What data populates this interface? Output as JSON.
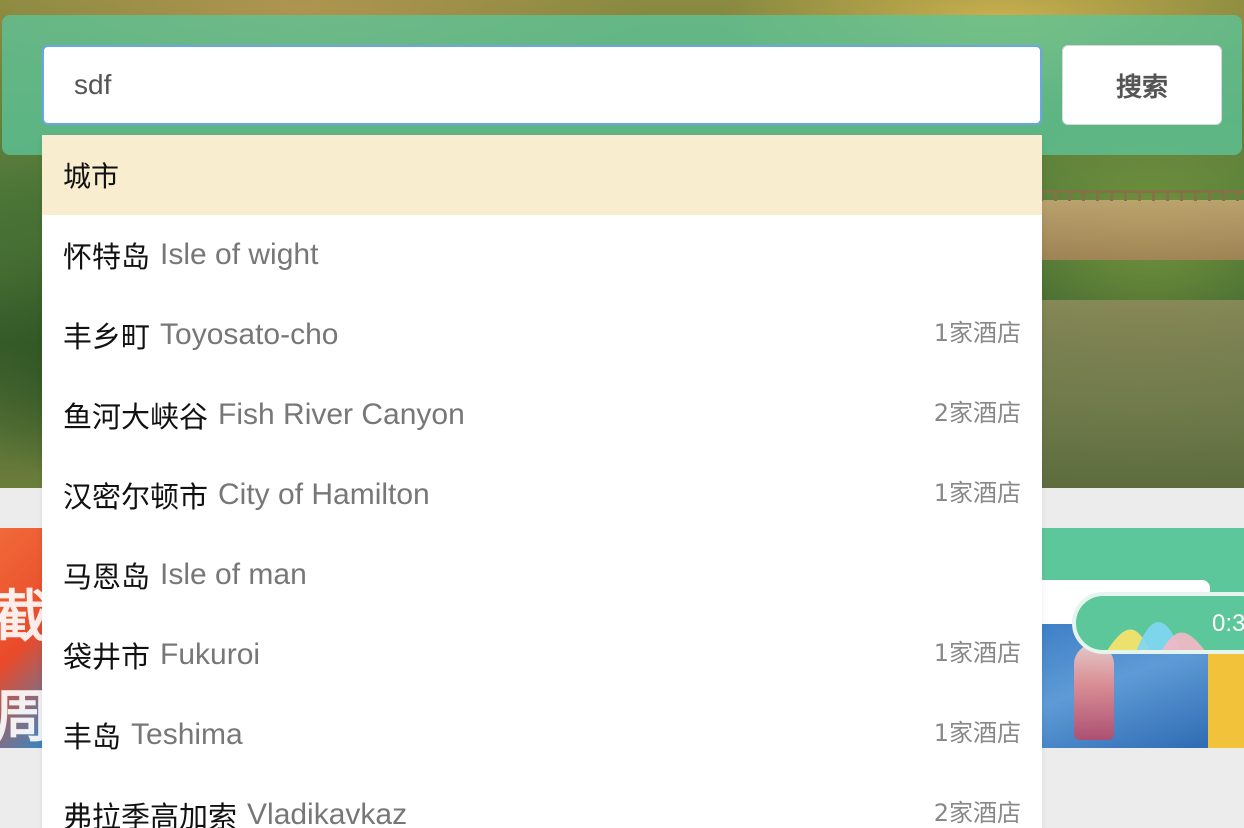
{
  "search": {
    "value": "sdf",
    "button_label": "搜索"
  },
  "dropdown": {
    "section_header": "城市",
    "items": [
      {
        "zh": "怀特岛",
        "en": "Isle of wight",
        "count": ""
      },
      {
        "zh": "丰乡町",
        "en": "Toyosato-cho",
        "count": "1家酒店"
      },
      {
        "zh": "鱼河大峡谷",
        "en": "Fish River Canyon",
        "count": "2家酒店"
      },
      {
        "zh": "汉密尔顿市",
        "en": "City of Hamilton",
        "count": "1家酒店"
      },
      {
        "zh": "马恩岛",
        "en": "Isle of man",
        "count": ""
      },
      {
        "zh": "袋井市",
        "en": "Fukuroi",
        "count": "1家酒店"
      },
      {
        "zh": "丰岛",
        "en": "Teshima",
        "count": "1家酒店"
      },
      {
        "zh": "弗拉季高加索",
        "en": "Vladikavkaz",
        "count": "2家酒店"
      }
    ]
  },
  "promo_left": {
    "text": "截\n周"
  },
  "audio_player": {
    "time": "0:3"
  },
  "colors": {
    "search_panel": "#5cc498",
    "header_highlight": "#f8edcf",
    "input_border": "#6aa6e6",
    "secondary_text": "#777777"
  },
  "icons": {
    "audio_wave": "audio-wave-icon"
  }
}
